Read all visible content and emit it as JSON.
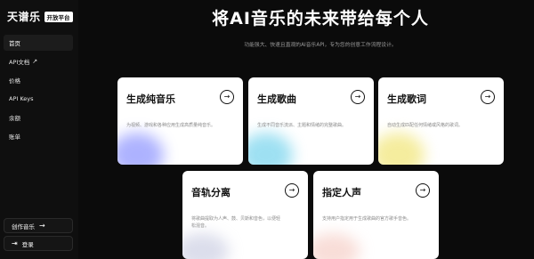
{
  "brand": {
    "name": "天谱乐",
    "tag": "开放平台"
  },
  "sidebar": {
    "items": [
      {
        "label": "首页",
        "active": true
      },
      {
        "label": "API文档",
        "external": true
      },
      {
        "label": "价格"
      },
      {
        "label": "API Keys"
      },
      {
        "label": "余额"
      },
      {
        "label": "账单"
      }
    ],
    "create_label": "创作音乐",
    "login_label": "登录"
  },
  "hero": {
    "title": "将AI音乐的未来带给每个人",
    "subtitle": "功能强大、快速且直观的AI音乐API，专为您的创意工作流程设计。"
  },
  "cards": [
    {
      "title": "生成纯音乐",
      "desc": "为视频、游戏和各种应用生成高质量纯音乐。",
      "accent": "#6b74ff"
    },
    {
      "title": "生成歌曲",
      "desc": "生成不同音乐流派、主题和情绪的完整歌曲。",
      "accent": "#4fc7e8"
    },
    {
      "title": "生成歌词",
      "desc": "自动生成匹配任何情绪或风格的歌词。",
      "accent": "#f0e36a"
    },
    {
      "title": "音轨分离",
      "desc": "将歌曲提取为人声、鼓、贝斯和音色，以便轻松混音。",
      "accent": "#b8bcd8"
    },
    {
      "title": "指定人声",
      "desc": "支持用户指定用于生成歌曲的官方歌手音色。",
      "accent": "#f3c2b8"
    }
  ],
  "colors": {
    "background": "#0b0b0b",
    "sidebar": "#0f0f0f",
    "card": "#ffffff"
  },
  "icons": {
    "external": "external-link-icon",
    "arrow": "arrow-right-icon",
    "login": "login-icon"
  }
}
